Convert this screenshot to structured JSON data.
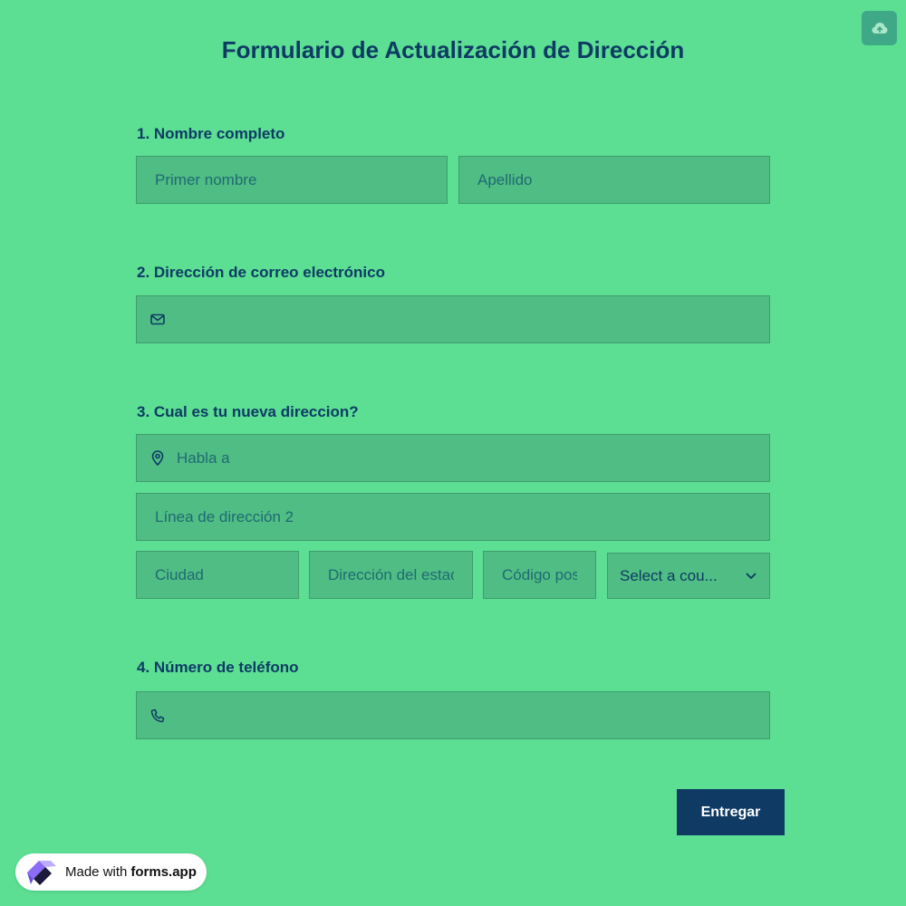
{
  "header": {
    "title": "Formulario de Actualización de Dirección",
    "save_icon": "cloud-upload-icon"
  },
  "questions": {
    "q1": {
      "label": "1.  Nombre completo",
      "first_name_placeholder": "Primer nombre",
      "last_name_placeholder": "Apellido"
    },
    "q2": {
      "label": "2. Dirección de correo electrónico",
      "email_value": "",
      "icon": "envelope-icon"
    },
    "q3": {
      "label": "3. Cual es tu nueva direccion?",
      "address1_placeholder": "Habla a",
      "address2_placeholder": "Línea de dirección 2",
      "city_placeholder": "Ciudad",
      "state_placeholder": "Dirección del estado",
      "zip_placeholder": "Código postal",
      "country_selected": "Select a cou...",
      "icon": "map-pin-icon"
    },
    "q4": {
      "label": "4. Número de teléfono",
      "phone_value": "",
      "icon": "phone-icon"
    }
  },
  "submit": {
    "label": "Entregar"
  },
  "badge": {
    "prefix": "Made with",
    "brand": "forms.app"
  },
  "colors": {
    "background": "#5cde93",
    "field": "#50bd84",
    "text": "#0e3b64",
    "button": "#0e3a64"
  }
}
